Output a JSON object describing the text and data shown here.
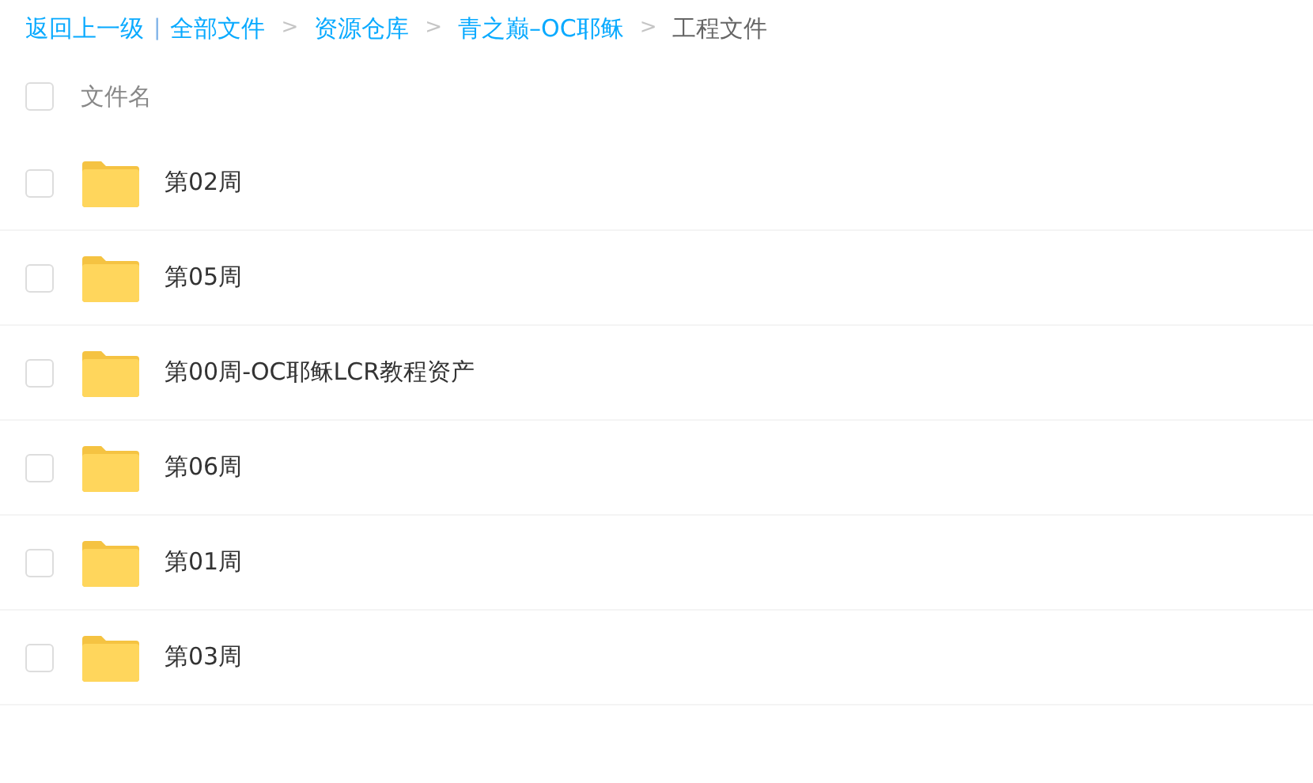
{
  "breadcrumb": {
    "back": "返回上一级",
    "divider": "|",
    "items": [
      {
        "label": "全部文件",
        "current": false
      },
      {
        "separator": ">",
        "label": "资源仓库",
        "current": false
      },
      {
        "separator": ">",
        "label": "青之巅–OC耶稣",
        "current": false
      },
      {
        "separator": ">",
        "label": "工程文件",
        "current": true
      }
    ]
  },
  "header": {
    "checked": false,
    "label": "文件名"
  },
  "files": [
    {
      "name": "第02周",
      "checked": false
    },
    {
      "name": "第05周",
      "checked": false
    },
    {
      "name": "第00周-OC耶稣LCR教程资产",
      "checked": false
    },
    {
      "name": "第06周",
      "checked": false
    },
    {
      "name": "第01周",
      "checked": false
    },
    {
      "name": "第03周",
      "checked": false
    }
  ]
}
